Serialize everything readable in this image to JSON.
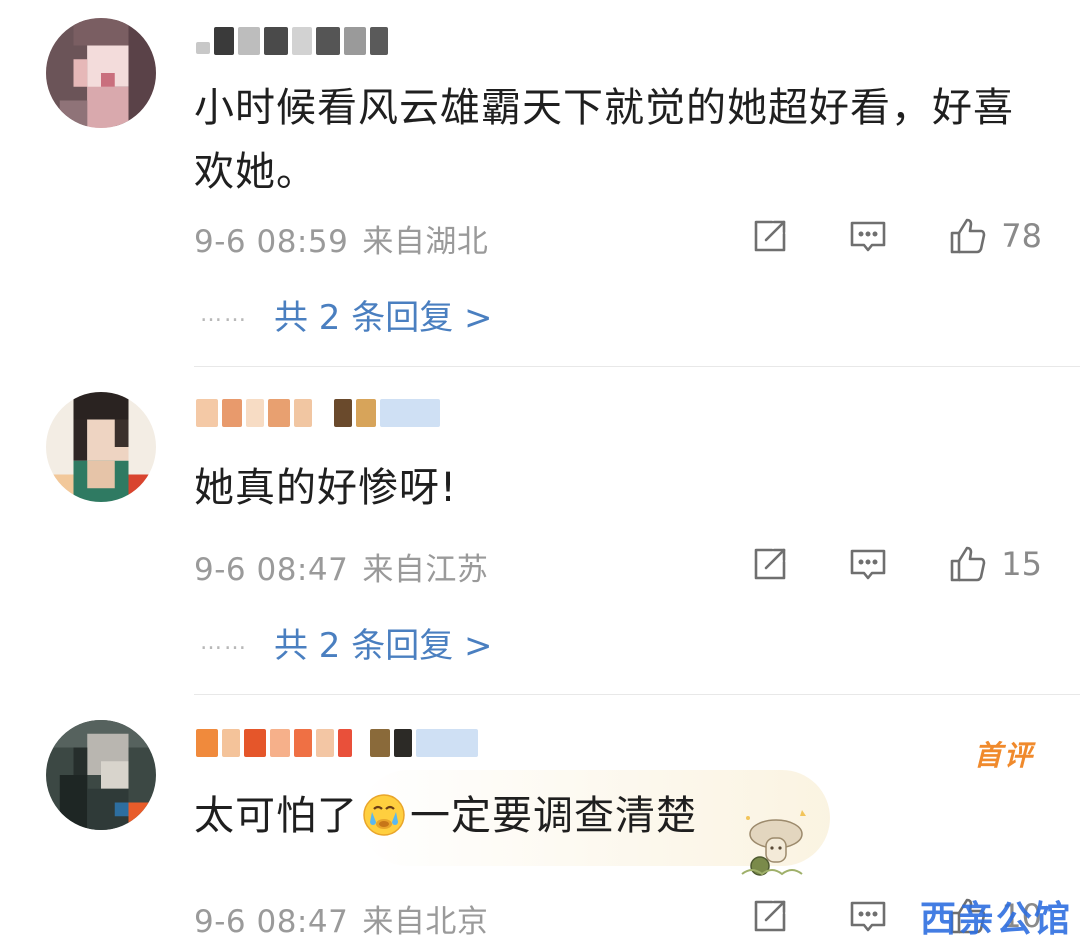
{
  "comments": [
    {
      "text": "小时候看风云雄霸天下就觉的她超好看，好喜欢她。",
      "date": "9-6 08:59",
      "location": "来自湖北",
      "likes": "78",
      "replies_dots": "……",
      "replies": "共 2 条回复 >"
    },
    {
      "text": "她真的好惨呀!",
      "date": "9-6 08:47",
      "location": "来自江苏",
      "likes": "15",
      "replies_dots": "……",
      "replies": "共 2 条回复 >"
    },
    {
      "text_before": "太可怕了",
      "text_after": "一定要调查清楚",
      "emoji": "crying-face-emoji",
      "badge": "首评",
      "date": "9-6 08:47",
      "location": "来自北京",
      "likes": "10"
    }
  ],
  "watermark": "西亲公馆",
  "icons": {
    "share": "share-icon",
    "comment": "comment-icon",
    "like": "thumbs-up-icon"
  },
  "colors": {
    "reply_link": "#4a7fc0",
    "meta_text": "#9a9a9a",
    "badge": "#f08a2c"
  }
}
